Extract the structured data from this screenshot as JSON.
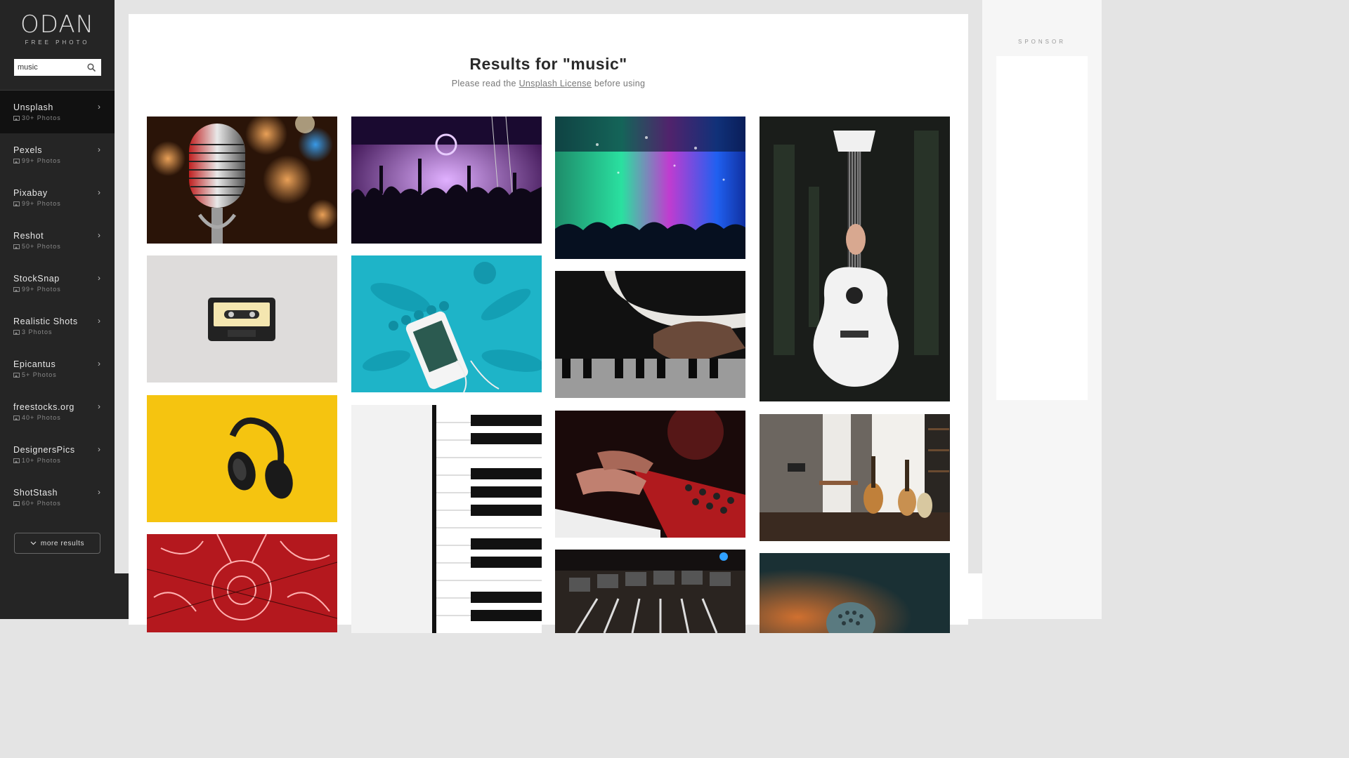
{
  "logo": {
    "main": "ODAN",
    "sub": "FREE PHOTO"
  },
  "search": {
    "value": "music",
    "icon": "search-icon"
  },
  "sources": [
    {
      "name": "Unsplash",
      "count": "30+ Photos",
      "active": true
    },
    {
      "name": "Pexels",
      "count": "99+ Photos"
    },
    {
      "name": "Pixabay",
      "count": "99+ Photos"
    },
    {
      "name": "Reshot",
      "count": "50+ Photos"
    },
    {
      "name": "StockSnap",
      "count": "99+ Photos"
    },
    {
      "name": "Realistic Shots",
      "count": "3 Photos"
    },
    {
      "name": "Epicantus",
      "count": "5+ Photos"
    },
    {
      "name": "freestocks.org",
      "count": "40+ Photos"
    },
    {
      "name": "DesignersPics",
      "count": "10+ Photos"
    },
    {
      "name": "ShotStash",
      "count": "60+ Photos"
    }
  ],
  "more_results": "more results",
  "results_title": "Results for \"music\"",
  "license": {
    "before": "Please read the ",
    "link": "Unsplash License",
    "after": " before using"
  },
  "sponsor_label": "SPONSOR",
  "colors": {
    "sidebar": "#252525",
    "sidebar_active": "#111111",
    "page_bg": "#e4e4e4",
    "card_bg": "#ffffff"
  }
}
